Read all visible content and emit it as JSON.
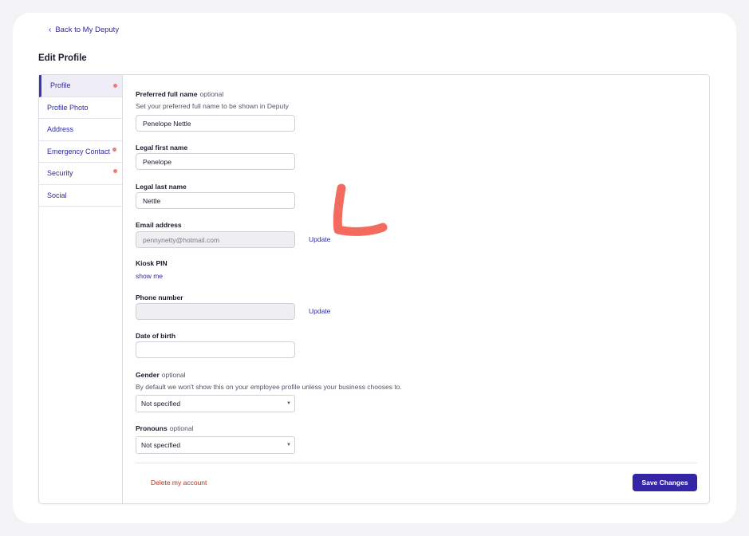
{
  "nav": {
    "back_label": "Back to My Deputy"
  },
  "page": {
    "title": "Edit Profile"
  },
  "sidebar": {
    "items": [
      {
        "label": "Profile",
        "active": true,
        "alert": true
      },
      {
        "label": "Profile Photo",
        "active": false,
        "alert": false
      },
      {
        "label": "Address",
        "active": false,
        "alert": false
      },
      {
        "label": "Emergency Contact",
        "active": false,
        "alert": true
      },
      {
        "label": "Security",
        "active": false,
        "alert": true
      },
      {
        "label": "Social",
        "active": false,
        "alert": false
      }
    ]
  },
  "form": {
    "preferred_name": {
      "label": "Preferred full name",
      "optional": "optional",
      "help": "Set your preferred full name to be shown in Deputy",
      "value": "Penelope Nettle"
    },
    "legal_first_name": {
      "label": "Legal first name",
      "value": "Penelope"
    },
    "legal_last_name": {
      "label": "Legal last name",
      "value": "Nettle"
    },
    "email": {
      "label": "Email address",
      "value": "pennynetty@hotmail.com",
      "action": "Update"
    },
    "kiosk_pin": {
      "label": "Kiosk PIN",
      "action": "show me"
    },
    "phone": {
      "label": "Phone number",
      "value": "",
      "action": "Update"
    },
    "dob": {
      "label": "Date of birth",
      "value": ""
    },
    "gender": {
      "label": "Gender",
      "optional": "optional",
      "help": "By default we won't show this on your employee profile unless your business chooses to.",
      "selected": "Not specified"
    },
    "pronouns": {
      "label": "Pronouns",
      "optional": "optional",
      "selected": "Not specified"
    }
  },
  "footer": {
    "delete_label": "Delete my account",
    "save_label": "Save Changes"
  },
  "colors": {
    "accent": "#3425a6",
    "link": "#2f2a9e",
    "alert_dot": "#f27c6c",
    "danger": "#b5321c",
    "annotation": "#f26b5e"
  },
  "icons": {
    "back": "chevron-left-icon",
    "select_caret": "caret-down-icon"
  }
}
